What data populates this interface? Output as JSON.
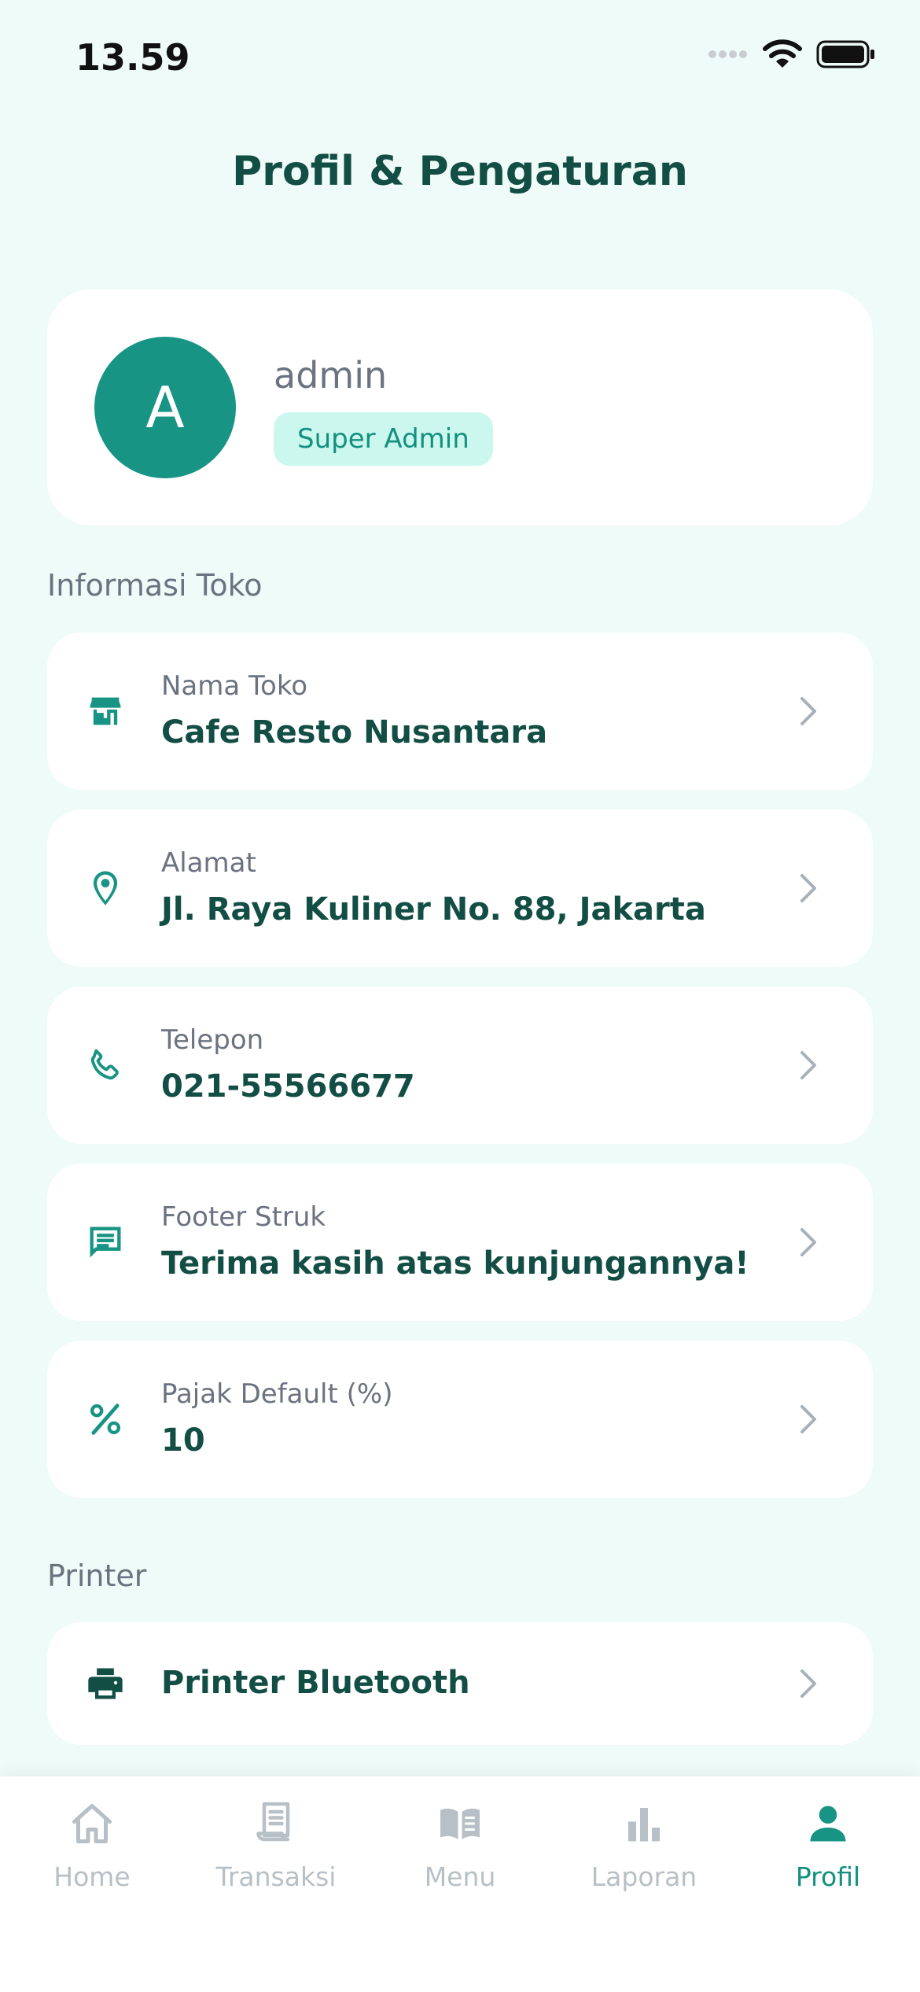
{
  "status_bar": {
    "time": "13.59"
  },
  "header": {
    "title": "Profil & Pengaturan"
  },
  "profile": {
    "initial": "A",
    "username": "admin",
    "role": "Super Admin"
  },
  "store_section": {
    "label": "Informasi Toko",
    "items": [
      {
        "label": "Nama Toko",
        "value": "Cafe Resto Nusantara",
        "icon": "store-icon"
      },
      {
        "label": "Alamat",
        "value": "Jl. Raya Kuliner No. 88, Jakarta",
        "icon": "location-pin-icon"
      },
      {
        "label": "Telepon",
        "value": "021-55566677",
        "icon": "phone-icon"
      },
      {
        "label": "Footer Struk",
        "value": "Terima kasih atas kunjungannya!",
        "icon": "message-icon"
      },
      {
        "label": "Pajak Default (%)",
        "value": "10",
        "icon": "percent-icon"
      }
    ]
  },
  "printer_section": {
    "label": "Printer",
    "items": [
      {
        "label": "Printer Bluetooth",
        "icon": "printer-icon"
      }
    ]
  },
  "tabs": [
    {
      "label": "Home",
      "icon": "home-icon",
      "active": false
    },
    {
      "label": "Transaksi",
      "icon": "receipt-icon",
      "active": false
    },
    {
      "label": "Menu",
      "icon": "book-icon",
      "active": false
    },
    {
      "label": "Laporan",
      "icon": "bar-chart-icon",
      "active": false
    },
    {
      "label": "Profil",
      "icon": "person-icon",
      "active": true
    }
  ],
  "colors": {
    "accent": "#189484",
    "title": "#134e45",
    "background": "#effbf8",
    "inactive_tab": "#b7c0c6"
  }
}
